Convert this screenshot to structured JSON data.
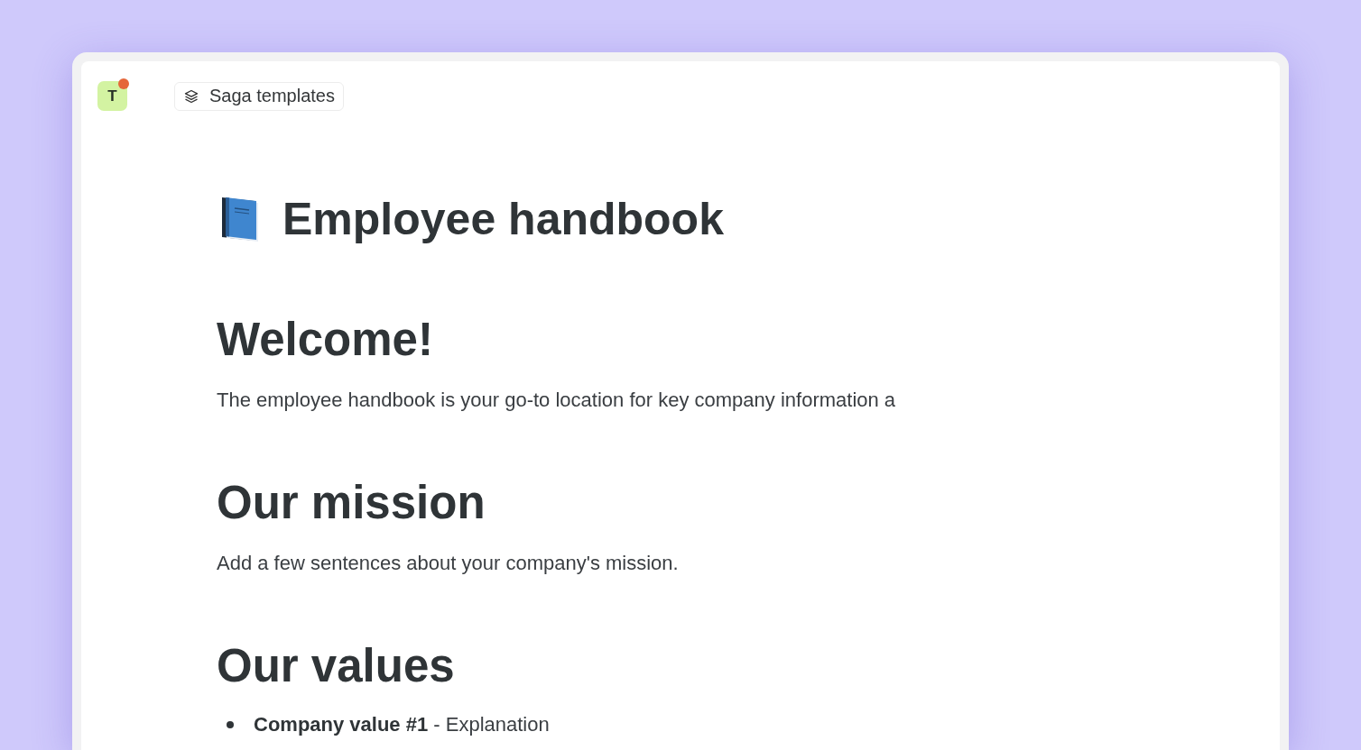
{
  "app": {
    "avatar": {
      "initial": "T",
      "notification": true
    },
    "templates_button": {
      "label": "Saga templates"
    }
  },
  "page": {
    "title": "Employee handbook",
    "sections": [
      {
        "heading": "Welcome!",
        "blocks": [
          {
            "kind": "paragraph",
            "text": "The employee handbook is your go-to location for key company information a"
          }
        ]
      },
      {
        "heading": "Our mission",
        "blocks": [
          {
            "kind": "paragraph",
            "text": "Add a few sentences about your company's mission."
          }
        ]
      },
      {
        "heading": "Our values",
        "blocks": [
          {
            "kind": "bullet",
            "text": "**Company value #1** - Explanation"
          }
        ]
      }
    ]
  }
}
